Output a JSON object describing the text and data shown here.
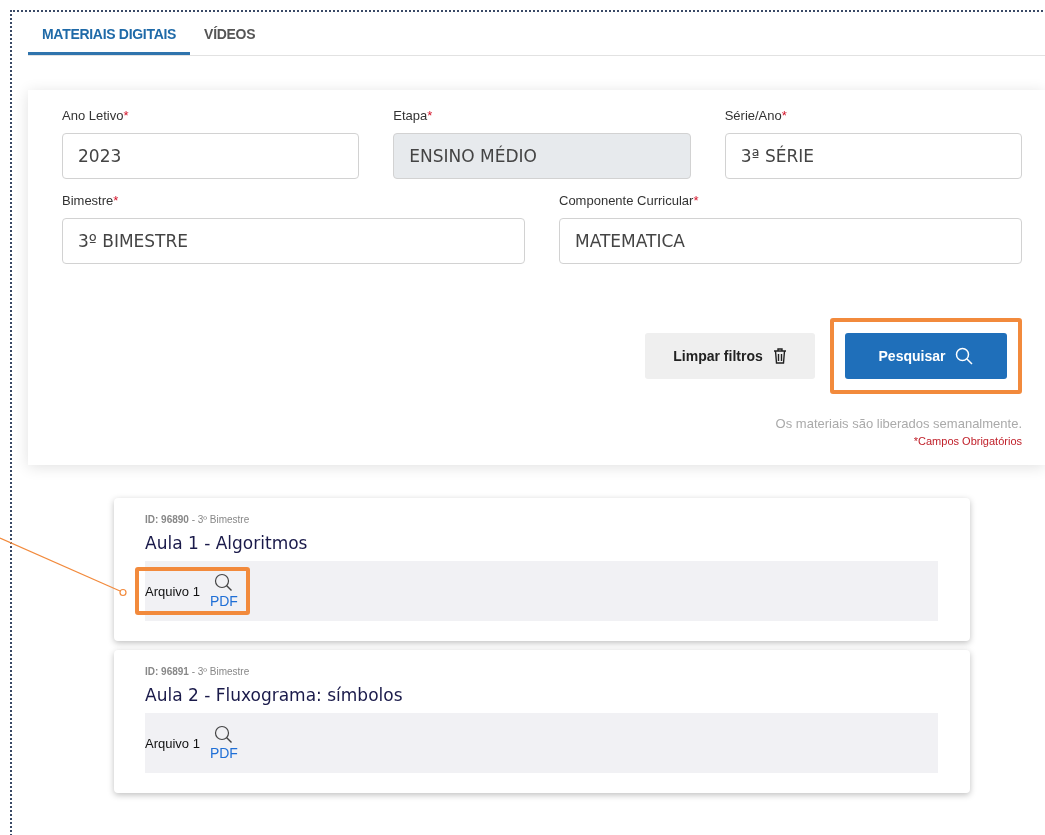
{
  "tabs": [
    {
      "label": "MATERIAIS DIGITAIS",
      "selected": true
    },
    {
      "label": "VÍDEOS",
      "selected": false
    }
  ],
  "filters": {
    "rows": [
      [
        {
          "label": "Ano Letivo",
          "required_mark": "*",
          "value": "2023",
          "disabled": false
        },
        {
          "label": "Etapa",
          "required_mark": "*",
          "value": "ENSINO MÉDIO",
          "disabled": true
        },
        {
          "label": "Série/Ano",
          "required_mark": "*",
          "value": "3ª SÉRIE",
          "disabled": false
        }
      ],
      [
        {
          "label": "Bimestre",
          "required_mark": "*",
          "value": "3º BIMESTRE",
          "disabled": false
        },
        {
          "label": "Componente Curricular",
          "required_mark": "*",
          "value": "MATEMATICA",
          "disabled": false
        }
      ]
    ],
    "clear_button": {
      "label": "Limpar filtros"
    },
    "search_button": {
      "label": "Pesquisar",
      "highlighted": true
    },
    "note": "Os materiais são liberados semanalmente.",
    "required_note": "*Campos Obrigatórios"
  },
  "materials": [
    {
      "meta": "**ID: 96890** - 3º Bimestre",
      "title": "Aula 1 - Algoritmos",
      "files": [
        {
          "label": "Arquivo 1",
          "type": "PDF",
          "highlighted": true
        }
      ]
    },
    {
      "meta": "**ID: 96891** - 3º Bimestre",
      "title": "Aula 2 - Fluxograma: símbolos",
      "files": [
        {
          "label": "Arquivo 1",
          "type": "PDF",
          "highlighted": false
        }
      ]
    }
  ]
}
